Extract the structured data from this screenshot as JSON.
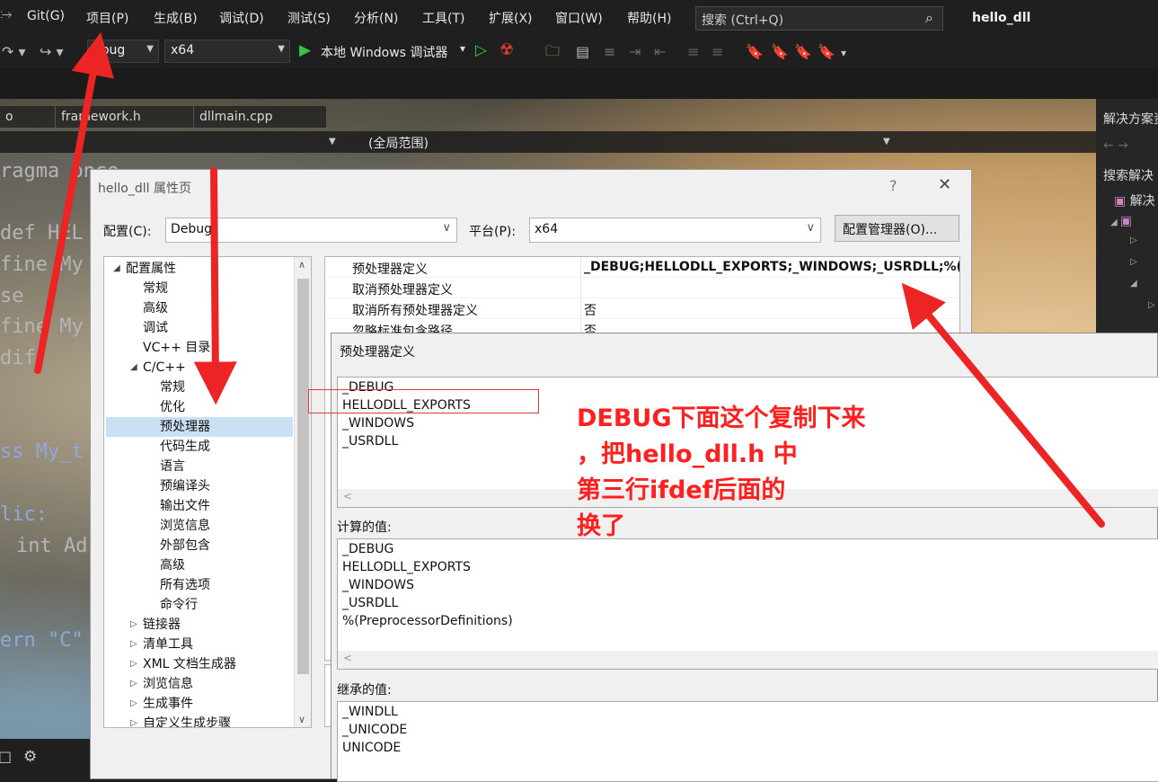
{
  "menubar": {
    "items": [
      "Git(G)",
      "项目(P)",
      "生成(B)",
      "调试(D)",
      "测试(S)",
      "分析(N)",
      "工具(T)",
      "扩展(X)",
      "窗口(W)",
      "帮助(H)"
    ],
    "search_placeholder": "搜索 (Ctrl+Q)",
    "search_icon": "magnifier-icon",
    "app_title": "hello_dll"
  },
  "toolbar": {
    "config_value": "ebug",
    "platform_value": "x64",
    "run_label": "本地 Windows 调试器",
    "run_dropdown": "▾"
  },
  "editor": {
    "tabs": [
      "o",
      "framework.h",
      "dllmain.cpp"
    ],
    "scope": "(全局范围)",
    "code_lines": [
      "ragma once",
      "def HEL",
      "fine My",
      "se",
      "fine My",
      "dif",
      "ss My_t",
      "lic:",
      "int Ad",
      "ern \"C\""
    ]
  },
  "solution_explorer": {
    "title": "解决方案资",
    "search": "搜索解决",
    "root": "解决"
  },
  "prop_dialog": {
    "title": "hello_dll 属性页",
    "help": "?",
    "close": "✕",
    "config_label": "配置(C):",
    "config_value": "Debug",
    "platform_label": "平台(P):",
    "platform_value": "x64",
    "config_manager": "配置管理器(O)...",
    "tree": [
      {
        "label": "配置属性",
        "level": 0,
        "expand": "◢"
      },
      {
        "label": "常规",
        "level": 1,
        "expand": ""
      },
      {
        "label": "高级",
        "level": 1,
        "expand": ""
      },
      {
        "label": "调试",
        "level": 1,
        "expand": ""
      },
      {
        "label": "VC++ 目录",
        "level": 1,
        "expand": ""
      },
      {
        "label": "C/C++",
        "level": 1,
        "expand": "◢"
      },
      {
        "label": "常规",
        "level": 2,
        "expand": ""
      },
      {
        "label": "优化",
        "level": 2,
        "expand": ""
      },
      {
        "label": "预处理器",
        "level": 2,
        "expand": "",
        "selected": true
      },
      {
        "label": "代码生成",
        "level": 2,
        "expand": ""
      },
      {
        "label": "语言",
        "level": 2,
        "expand": ""
      },
      {
        "label": "预编译头",
        "level": 2,
        "expand": ""
      },
      {
        "label": "输出文件",
        "level": 2,
        "expand": ""
      },
      {
        "label": "浏览信息",
        "level": 2,
        "expand": ""
      },
      {
        "label": "外部包含",
        "level": 2,
        "expand": ""
      },
      {
        "label": "高级",
        "level": 2,
        "expand": ""
      },
      {
        "label": "所有选项",
        "level": 2,
        "expand": ""
      },
      {
        "label": "命令行",
        "level": 2,
        "expand": ""
      },
      {
        "label": "链接器",
        "level": 1,
        "expand": "▷"
      },
      {
        "label": "清单工具",
        "level": 1,
        "expand": "▷"
      },
      {
        "label": "XML 文档生成器",
        "level": 1,
        "expand": "▷"
      },
      {
        "label": "浏览信息",
        "level": 1,
        "expand": "▷"
      },
      {
        "label": "生成事件",
        "level": 1,
        "expand": "▷"
      },
      {
        "label": "自定义生成步骤",
        "level": 1,
        "expand": "▷"
      }
    ],
    "grid": [
      {
        "name": "预处理器定义",
        "value": "_DEBUG;HELLODLL_EXPORTS;_WINDOWS;_USRDLL;%(P",
        "bold": true
      },
      {
        "name": "取消预处理器定义",
        "value": "",
        "bold": false
      },
      {
        "name": "取消所有预处理器定义",
        "value": "否",
        "bold": false
      },
      {
        "name": "忽略标准包含路径",
        "value": "否",
        "bold": false
      }
    ]
  },
  "pp_dialog": {
    "title": "预处理器定义",
    "definitions": [
      "_DEBUG",
      "HELLODLL_EXPORTS",
      "_WINDOWS",
      "_USRDLL"
    ],
    "computed_label": "计算的值:",
    "computed": [
      "_DEBUG",
      "HELLODLL_EXPORTS",
      "_WINDOWS",
      "_USRDLL",
      "%(PreprocessorDefinitions)"
    ],
    "inherited_label": "继承的值:",
    "inherited": [
      "_WINDLL",
      "_UNICODE",
      "UNICODE"
    ]
  },
  "annotation": {
    "lines": [
      "DEBUG下面这个复制下来",
      "，把hello_dll.h 中",
      "第三行ifdef后面的",
      "换了"
    ],
    "color": "#ff1f1f"
  }
}
